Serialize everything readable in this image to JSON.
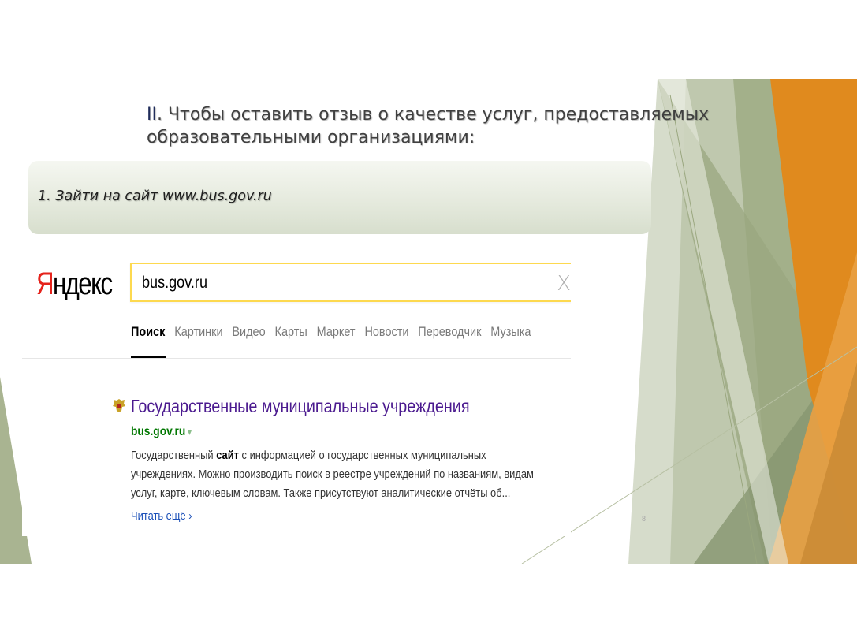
{
  "slide": {
    "title_number": "II",
    "title_line1": ". Чтобы оставить отзыв о качестве услуг, предоставляемых",
    "title_line2": "образовательными организациями:",
    "step_text": "1. Зайти на сайт www.bus.gov.ru",
    "page_number": "8"
  },
  "yandex": {
    "logo_first": "Я",
    "logo_rest": "ндекс",
    "search_value": "bus.gov.ru",
    "clear_glyph": "X",
    "tabs": [
      "Поиск",
      "Картинки",
      "Видео",
      "Карты",
      "Маркет",
      "Новости",
      "Переводчик",
      "Музыка"
    ],
    "result": {
      "title": "Государственные муниципальные учреждения",
      "url": "bus.gov.ru",
      "url_caret": "▾",
      "snippet_line1_pre": "Государственный ",
      "snippet_line1_bold": "сайт",
      "snippet_line1_post": " с информацией о государственных муниципальных",
      "snippet_line2": "учреждениях. Можно производить поиск в реестре учреждений по названиям, видам",
      "snippet_line3": "услуг, карте, ключевым словам. Также присутствуют аналитические отчёты об...",
      "more": "Читать ещё ›"
    }
  },
  "colors": {
    "yandex_red": "#e5221b",
    "search_border": "#fdd94f",
    "result_title": "#4b1a8f",
    "result_url": "#007700",
    "more_link": "#1a4fb8",
    "deco_green": "#8e9e74",
    "deco_orange": "#e08a1e"
  }
}
